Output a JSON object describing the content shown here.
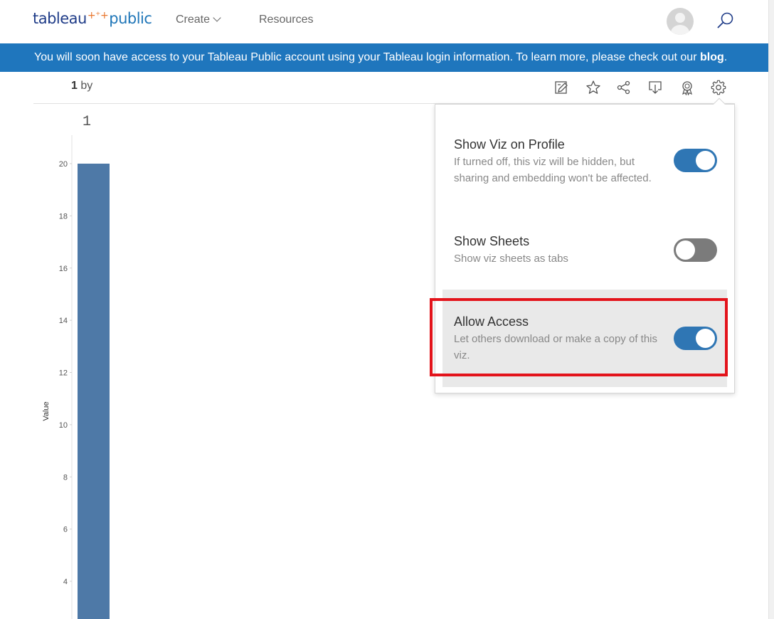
{
  "nav": {
    "logo_left": "tableau",
    "logo_plus": "+⁺+",
    "logo_right": "public",
    "create_label": "Create",
    "resources_label": "Resources",
    "icons": {
      "avatar": "user-avatar",
      "search": "search-icon",
      "create_menu": "chevron-down-icon"
    }
  },
  "banner": {
    "text": "You will soon have access to your Tableau Public account using your Tableau login information. To learn more, please check out our ",
    "link": "blog",
    "end": ".",
    "color": "#1f76bd"
  },
  "viz": {
    "count": "1",
    "by": "by",
    "toolbar_icons": [
      "edit-icon",
      "favorite-star-icon",
      "share-icon",
      "download-icon",
      "award-icon",
      "settings-gear-icon"
    ]
  },
  "settings": {
    "show_viz": {
      "title": "Show Viz on Profile",
      "description": "If turned off, this viz will be hidden, but sharing and embedding won't be affected.",
      "enabled": true
    },
    "show_sheets": {
      "title": "Show Sheets",
      "description": "Show viz sheets as tabs",
      "enabled": false
    },
    "allow_access": {
      "title": "Allow Access",
      "description": "Let others download or make a copy of this viz.",
      "enabled": true,
      "highlighted": true
    },
    "toggle_on_color": "#2f76b4",
    "toggle_off_color": "#7b7b7b",
    "highlight_color": "#e3131b"
  },
  "chart_data": {
    "type": "bar",
    "title": "1",
    "ylabel": "Value",
    "xlabel": "",
    "categories": [
      "1"
    ],
    "values": [
      20
    ],
    "ylim": [
      2.6,
      20.8
    ],
    "yticks": [
      4,
      6,
      8,
      10,
      12,
      14,
      16,
      18,
      20
    ],
    "bar_color": "#4e79a7",
    "grid": false
  }
}
